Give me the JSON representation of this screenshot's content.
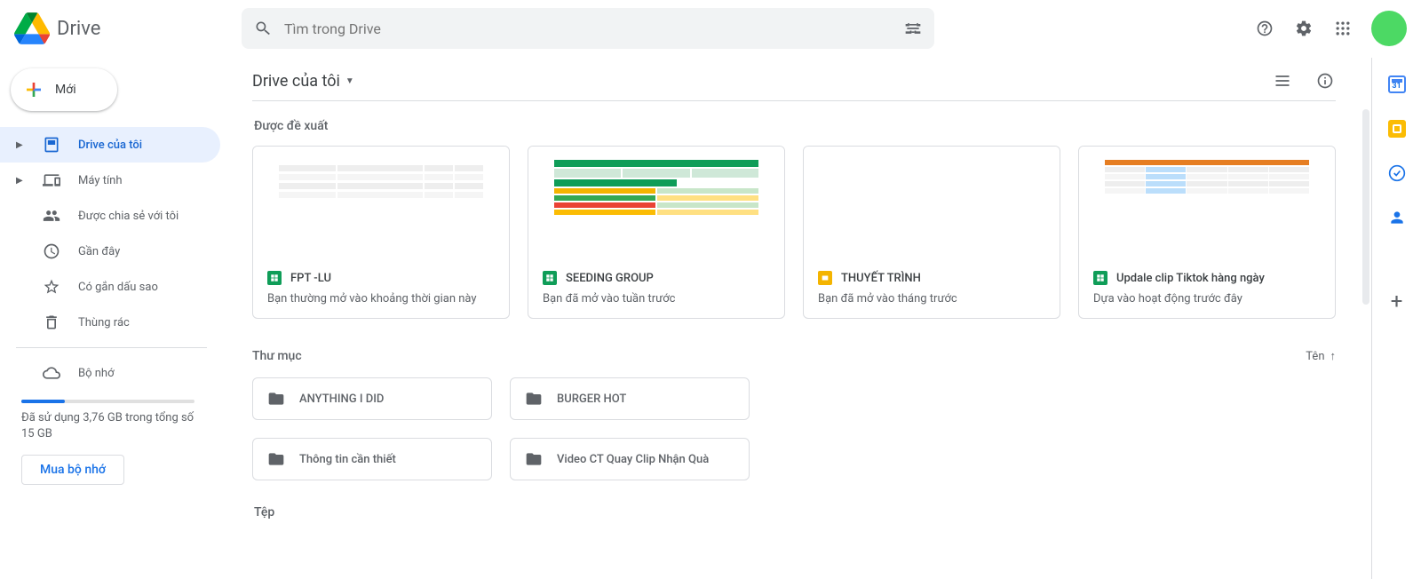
{
  "header": {
    "product": "Drive",
    "search_placeholder": "Tìm trong Drive"
  },
  "sidebar": {
    "new_label": "Mới",
    "items": [
      {
        "label": "Drive của tôi",
        "expandable": true,
        "active": true
      },
      {
        "label": "Máy tính",
        "expandable": true,
        "active": false
      },
      {
        "label": "Được chia sẻ với tôi",
        "expandable": false,
        "active": false
      },
      {
        "label": "Gần đây",
        "expandable": false,
        "active": false
      },
      {
        "label": "Có gắn dấu sao",
        "expandable": false,
        "active": false
      },
      {
        "label": "Thùng rác",
        "expandable": false,
        "active": false
      }
    ],
    "storage_label": "Bộ nhớ",
    "storage_text": "Đã sử dụng 3,76 GB trong tổng số 15 GB",
    "storage_percent": 25,
    "buy_label": "Mua bộ nhớ"
  },
  "main": {
    "page_title": "Drive của tôi",
    "suggested_label": "Được đề xuất",
    "suggested": [
      {
        "name": "FPT -LU",
        "subtitle": "Bạn thường mở vào khoảng thời gian này",
        "type": "sheet"
      },
      {
        "name": "SEEDING GROUP",
        "subtitle": "Bạn đã mở vào tuần trước",
        "type": "sheet"
      },
      {
        "name": "THUYẾT TRÌNH",
        "subtitle": "Bạn đã mở vào tháng trước",
        "type": "slides"
      },
      {
        "name": "Updale clip Tiktok hàng ngày",
        "subtitle": "Dựa vào hoạt động trước đây",
        "type": "sheet"
      }
    ],
    "folders_label": "Thư mục",
    "sort_label": "Tên",
    "folders": [
      {
        "name": "ANYTHING I DID",
        "shared": false
      },
      {
        "name": "BURGER HOT",
        "shared": true
      },
      {
        "name": "Thông tin cần thiết",
        "shared": true
      },
      {
        "name": "Video CT Quay Clip Nhận Quà",
        "shared": true
      }
    ],
    "files_label": "Tệp"
  }
}
